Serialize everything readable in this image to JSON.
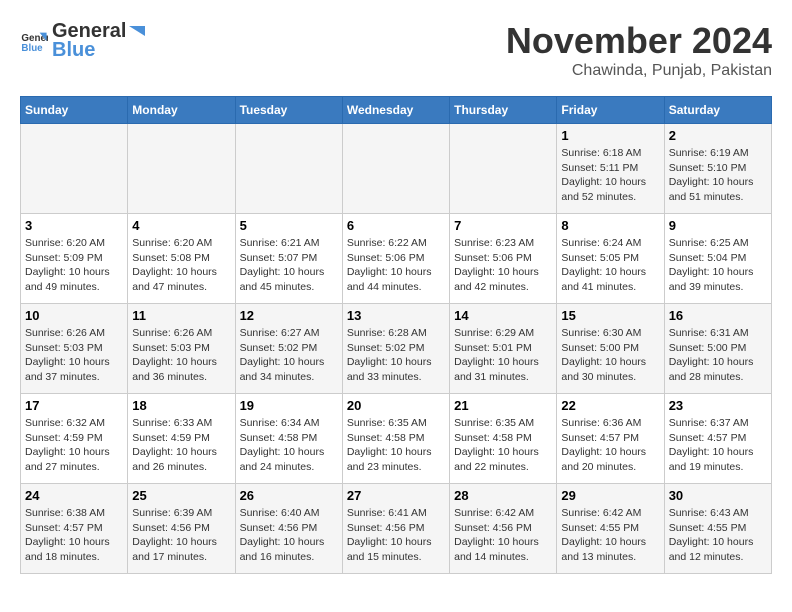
{
  "header": {
    "logo_general": "General",
    "logo_blue": "Blue",
    "month_title": "November 2024",
    "location": "Chawinda, Punjab, Pakistan"
  },
  "weekdays": [
    "Sunday",
    "Monday",
    "Tuesday",
    "Wednesday",
    "Thursday",
    "Friday",
    "Saturday"
  ],
  "weeks": [
    [
      {
        "day": "",
        "info": ""
      },
      {
        "day": "",
        "info": ""
      },
      {
        "day": "",
        "info": ""
      },
      {
        "day": "",
        "info": ""
      },
      {
        "day": "",
        "info": ""
      },
      {
        "day": "1",
        "info": "Sunrise: 6:18 AM\nSunset: 5:11 PM\nDaylight: 10 hours\nand 52 minutes."
      },
      {
        "day": "2",
        "info": "Sunrise: 6:19 AM\nSunset: 5:10 PM\nDaylight: 10 hours\nand 51 minutes."
      }
    ],
    [
      {
        "day": "3",
        "info": "Sunrise: 6:20 AM\nSunset: 5:09 PM\nDaylight: 10 hours\nand 49 minutes."
      },
      {
        "day": "4",
        "info": "Sunrise: 6:20 AM\nSunset: 5:08 PM\nDaylight: 10 hours\nand 47 minutes."
      },
      {
        "day": "5",
        "info": "Sunrise: 6:21 AM\nSunset: 5:07 PM\nDaylight: 10 hours\nand 45 minutes."
      },
      {
        "day": "6",
        "info": "Sunrise: 6:22 AM\nSunset: 5:06 PM\nDaylight: 10 hours\nand 44 minutes."
      },
      {
        "day": "7",
        "info": "Sunrise: 6:23 AM\nSunset: 5:06 PM\nDaylight: 10 hours\nand 42 minutes."
      },
      {
        "day": "8",
        "info": "Sunrise: 6:24 AM\nSunset: 5:05 PM\nDaylight: 10 hours\nand 41 minutes."
      },
      {
        "day": "9",
        "info": "Sunrise: 6:25 AM\nSunset: 5:04 PM\nDaylight: 10 hours\nand 39 minutes."
      }
    ],
    [
      {
        "day": "10",
        "info": "Sunrise: 6:26 AM\nSunset: 5:03 PM\nDaylight: 10 hours\nand 37 minutes."
      },
      {
        "day": "11",
        "info": "Sunrise: 6:26 AM\nSunset: 5:03 PM\nDaylight: 10 hours\nand 36 minutes."
      },
      {
        "day": "12",
        "info": "Sunrise: 6:27 AM\nSunset: 5:02 PM\nDaylight: 10 hours\nand 34 minutes."
      },
      {
        "day": "13",
        "info": "Sunrise: 6:28 AM\nSunset: 5:02 PM\nDaylight: 10 hours\nand 33 minutes."
      },
      {
        "day": "14",
        "info": "Sunrise: 6:29 AM\nSunset: 5:01 PM\nDaylight: 10 hours\nand 31 minutes."
      },
      {
        "day": "15",
        "info": "Sunrise: 6:30 AM\nSunset: 5:00 PM\nDaylight: 10 hours\nand 30 minutes."
      },
      {
        "day": "16",
        "info": "Sunrise: 6:31 AM\nSunset: 5:00 PM\nDaylight: 10 hours\nand 28 minutes."
      }
    ],
    [
      {
        "day": "17",
        "info": "Sunrise: 6:32 AM\nSunset: 4:59 PM\nDaylight: 10 hours\nand 27 minutes."
      },
      {
        "day": "18",
        "info": "Sunrise: 6:33 AM\nSunset: 4:59 PM\nDaylight: 10 hours\nand 26 minutes."
      },
      {
        "day": "19",
        "info": "Sunrise: 6:34 AM\nSunset: 4:58 PM\nDaylight: 10 hours\nand 24 minutes."
      },
      {
        "day": "20",
        "info": "Sunrise: 6:35 AM\nSunset: 4:58 PM\nDaylight: 10 hours\nand 23 minutes."
      },
      {
        "day": "21",
        "info": "Sunrise: 6:35 AM\nSunset: 4:58 PM\nDaylight: 10 hours\nand 22 minutes."
      },
      {
        "day": "22",
        "info": "Sunrise: 6:36 AM\nSunset: 4:57 PM\nDaylight: 10 hours\nand 20 minutes."
      },
      {
        "day": "23",
        "info": "Sunrise: 6:37 AM\nSunset: 4:57 PM\nDaylight: 10 hours\nand 19 minutes."
      }
    ],
    [
      {
        "day": "24",
        "info": "Sunrise: 6:38 AM\nSunset: 4:57 PM\nDaylight: 10 hours\nand 18 minutes."
      },
      {
        "day": "25",
        "info": "Sunrise: 6:39 AM\nSunset: 4:56 PM\nDaylight: 10 hours\nand 17 minutes."
      },
      {
        "day": "26",
        "info": "Sunrise: 6:40 AM\nSunset: 4:56 PM\nDaylight: 10 hours\nand 16 minutes."
      },
      {
        "day": "27",
        "info": "Sunrise: 6:41 AM\nSunset: 4:56 PM\nDaylight: 10 hours\nand 15 minutes."
      },
      {
        "day": "28",
        "info": "Sunrise: 6:42 AM\nSunset: 4:56 PM\nDaylight: 10 hours\nand 14 minutes."
      },
      {
        "day": "29",
        "info": "Sunrise: 6:42 AM\nSunset: 4:55 PM\nDaylight: 10 hours\nand 13 minutes."
      },
      {
        "day": "30",
        "info": "Sunrise: 6:43 AM\nSunset: 4:55 PM\nDaylight: 10 hours\nand 12 minutes."
      }
    ]
  ]
}
